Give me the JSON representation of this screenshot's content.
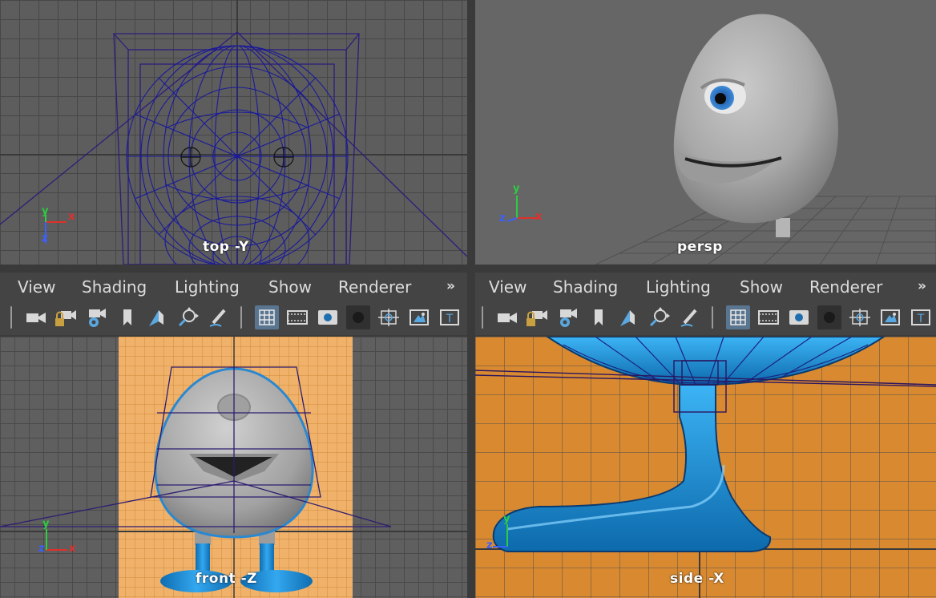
{
  "viewports": {
    "top": {
      "label": "top -Y"
    },
    "persp": {
      "label": "persp"
    },
    "front": {
      "label": "front -Z"
    },
    "side": {
      "label": "side -X"
    }
  },
  "panel_menu": {
    "items": [
      "View",
      "Shading",
      "Lighting",
      "Show",
      "Renderer"
    ],
    "overflow": "»"
  },
  "axis": {
    "x": "x",
    "y": "y",
    "z": "z"
  },
  "toolbar_icons": [
    "camera-icon",
    "lock-camera-icon",
    "camera-attributes-icon",
    "bookmark-icon",
    "image-plane-icon",
    "2d-pan-zoom-icon",
    "grease-pencil-icon",
    "grid-icon",
    "film-gate-icon",
    "resolution-gate-icon",
    "gate-mask-icon",
    "field-chart-icon",
    "safe-action-icon",
    "safe-title-icon"
  ],
  "colors": {
    "panel_bg": "#444444",
    "viewport_gray": "#5d5d5d",
    "image_plane_orange": "#d98b32",
    "model_blue": "#1a8fd6",
    "wireframe": "#1a1a8c",
    "active_button": "#5a7590"
  }
}
